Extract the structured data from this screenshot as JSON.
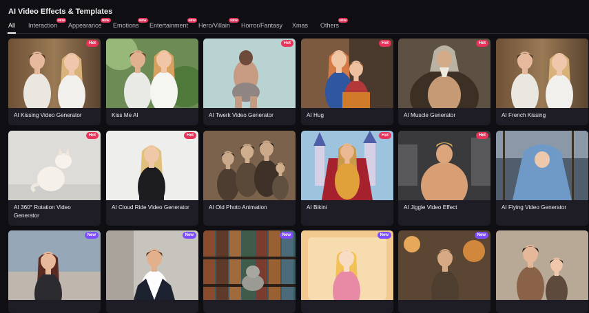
{
  "page": {
    "title": "AI Video Effects & Templates"
  },
  "tabs": [
    {
      "label": "All",
      "active": true,
      "badge": ""
    },
    {
      "label": "Interaction",
      "active": false,
      "badge": "NEW"
    },
    {
      "label": "Appearance",
      "active": false,
      "badge": "NEW"
    },
    {
      "label": "Emotions",
      "active": false,
      "badge": "NEW"
    },
    {
      "label": "Entertainment",
      "active": false,
      "badge": "NEW"
    },
    {
      "label": "Hero/Villain",
      "active": false,
      "badge": "NEW"
    },
    {
      "label": "Horror/Fantasy",
      "active": false,
      "badge": ""
    },
    {
      "label": "Xmas",
      "active": false,
      "badge": ""
    },
    {
      "label": "Others",
      "active": false,
      "badge": "NEW"
    }
  ],
  "cards": [
    {
      "label": "AI Kissing Video Generator",
      "badge": "Hot",
      "scene": "couple"
    },
    {
      "label": "Kiss Me AI",
      "badge": "",
      "scene": "couple-outdoor"
    },
    {
      "label": "AI Twerk Video Generator",
      "badge": "Hot",
      "scene": "dancer"
    },
    {
      "label": "AI Hug",
      "badge": "Hot",
      "scene": "hug"
    },
    {
      "label": "AI Muscle Generator",
      "badge": "Hot",
      "scene": "portrait-old"
    },
    {
      "label": "AI French Kissing",
      "badge": "",
      "scene": "couple"
    },
    {
      "label": "AI 360° Rotation Video Generator",
      "badge": "Hot",
      "scene": "cat"
    },
    {
      "label": "AI Cloud Ride Video Generator",
      "badge": "Hot",
      "scene": "woman-dress"
    },
    {
      "label": "AI Old Photo Animation",
      "badge": "",
      "scene": "family-sepia"
    },
    {
      "label": "AI Bikini",
      "badge": "Hot",
      "scene": "castle"
    },
    {
      "label": "AI Jiggle Video Effect",
      "badge": "Hot",
      "scene": "gym"
    },
    {
      "label": "AI Flying Video Generator",
      "badge": "",
      "scene": "ship"
    },
    {
      "label": "",
      "badge": "New",
      "scene": "beach"
    },
    {
      "label": "",
      "badge": "New",
      "scene": "man-office"
    },
    {
      "label": "",
      "badge": "New",
      "scene": "library-cat"
    },
    {
      "label": "",
      "badge": "New",
      "scene": "anime"
    },
    {
      "label": "",
      "badge": "New",
      "scene": "old-man-street"
    },
    {
      "label": "",
      "badge": "",
      "scene": "father-son"
    }
  ]
}
